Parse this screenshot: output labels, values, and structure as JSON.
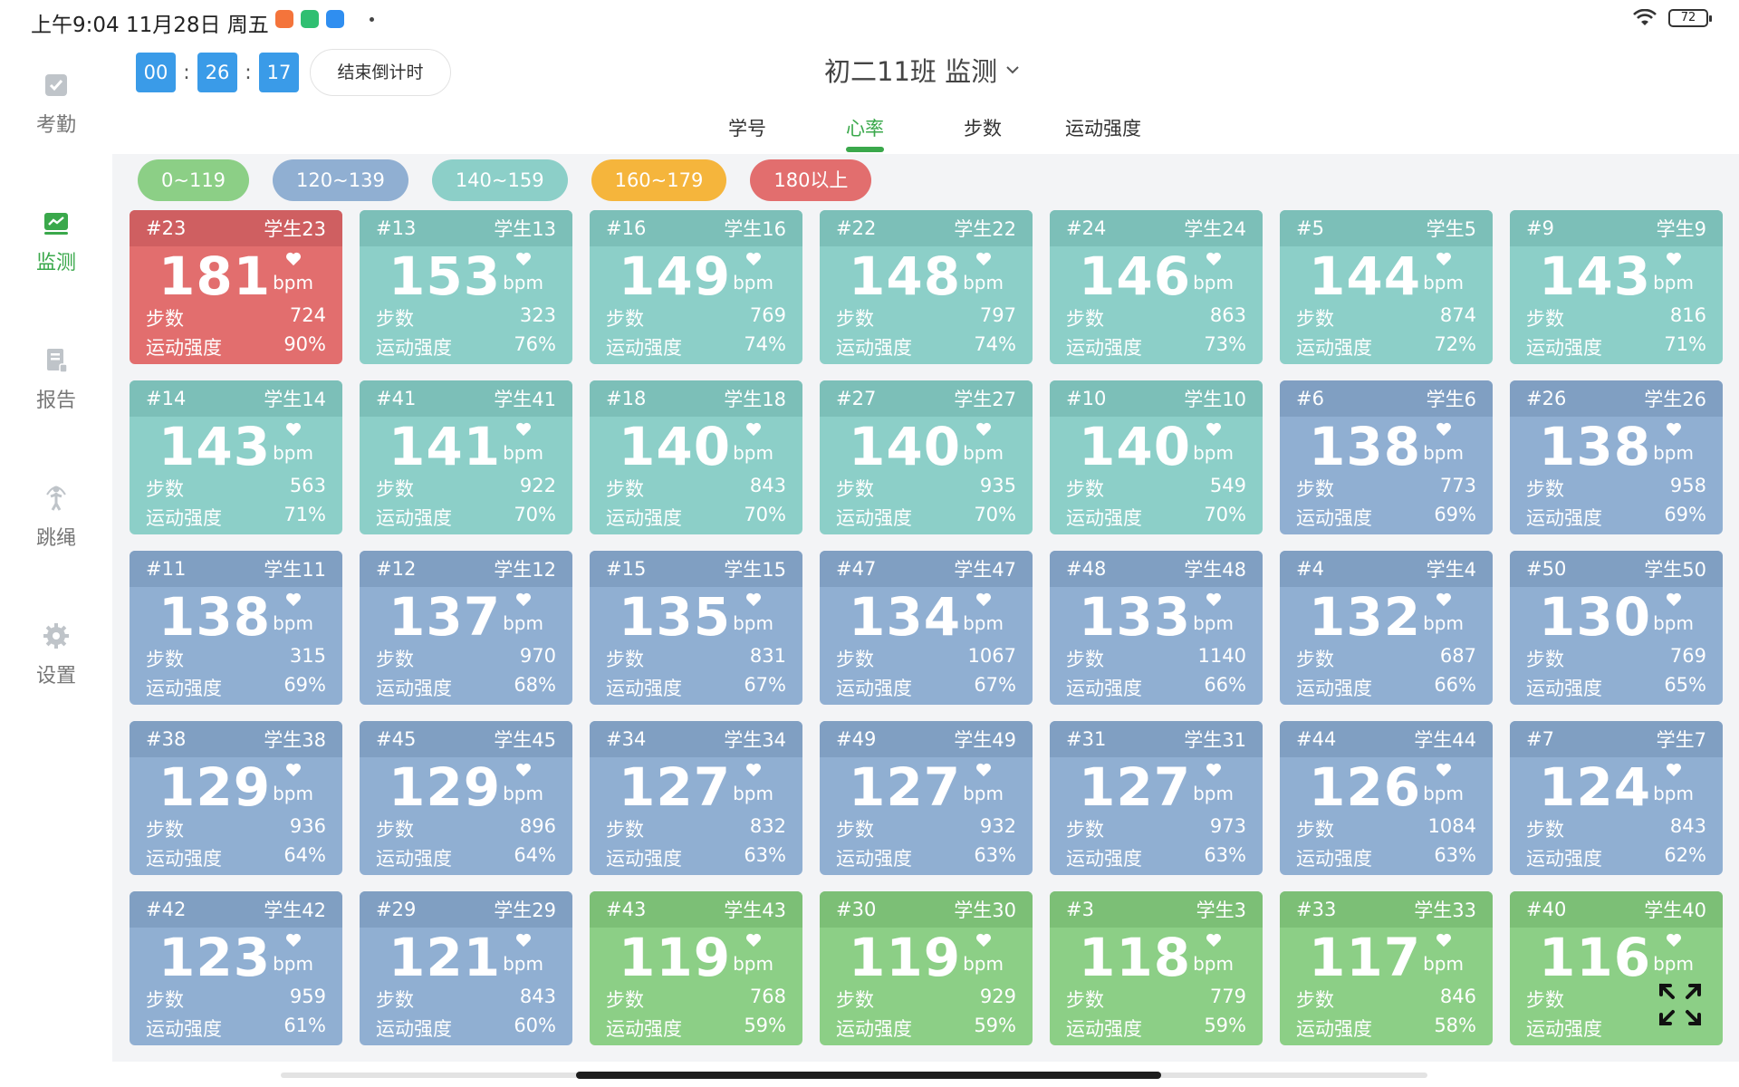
{
  "status": {
    "time": "上午9:04 11月28日 周五",
    "battery": "72"
  },
  "sidebar": {
    "items": [
      {
        "label": "考勤",
        "icon": "check-icon",
        "active": false
      },
      {
        "label": "监测",
        "icon": "monitor-chart-icon",
        "active": true
      },
      {
        "label": "报告",
        "icon": "report-icon",
        "active": false
      },
      {
        "label": "跳绳",
        "icon": "jump-rope-icon",
        "active": false
      },
      {
        "label": "设置",
        "icon": "gear-icon",
        "active": false
      }
    ]
  },
  "timer": {
    "h": "00",
    "m": "26",
    "s": "17",
    "sep": ":"
  },
  "end_button": "结束倒计时",
  "class_title": "初二11班 监测",
  "tabs": [
    {
      "label": "学号",
      "active": false
    },
    {
      "label": "心率",
      "active": true
    },
    {
      "label": "步数",
      "active": false
    },
    {
      "label": "运动强度",
      "active": false
    }
  ],
  "legend": [
    {
      "label": "0~119",
      "color": "#8ccf86"
    },
    {
      "label": "120~139",
      "color": "#90afd2"
    },
    {
      "label": "140~159",
      "color": "#8ccfc8"
    },
    {
      "label": "160~179",
      "color": "#f5b53c"
    },
    {
      "label": "180以上",
      "color": "#e26e6e"
    }
  ],
  "labels": {
    "unit": "bpm",
    "steps": "步数",
    "intensity": "运动强度"
  },
  "students": [
    {
      "id": "#23",
      "name": "学生23",
      "hr": "181",
      "steps": "724",
      "intensity": "90%"
    },
    {
      "id": "#13",
      "name": "学生13",
      "hr": "153",
      "steps": "323",
      "intensity": "76%"
    },
    {
      "id": "#16",
      "name": "学生16",
      "hr": "149",
      "steps": "769",
      "intensity": "74%"
    },
    {
      "id": "#22",
      "name": "学生22",
      "hr": "148",
      "steps": "797",
      "intensity": "74%"
    },
    {
      "id": "#24",
      "name": "学生24",
      "hr": "146",
      "steps": "863",
      "intensity": "73%"
    },
    {
      "id": "#5",
      "name": "学生5",
      "hr": "144",
      "steps": "874",
      "intensity": "72%"
    },
    {
      "id": "#9",
      "name": "学生9",
      "hr": "143",
      "steps": "816",
      "intensity": "71%"
    },
    {
      "id": "#14",
      "name": "学生14",
      "hr": "143",
      "steps": "563",
      "intensity": "71%"
    },
    {
      "id": "#41",
      "name": "学生41",
      "hr": "141",
      "steps": "922",
      "intensity": "70%"
    },
    {
      "id": "#18",
      "name": "学生18",
      "hr": "140",
      "steps": "843",
      "intensity": "70%"
    },
    {
      "id": "#27",
      "name": "学生27",
      "hr": "140",
      "steps": "935",
      "intensity": "70%"
    },
    {
      "id": "#10",
      "name": "学生10",
      "hr": "140",
      "steps": "549",
      "intensity": "70%"
    },
    {
      "id": "#6",
      "name": "学生6",
      "hr": "138",
      "steps": "773",
      "intensity": "69%"
    },
    {
      "id": "#26",
      "name": "学生26",
      "hr": "138",
      "steps": "958",
      "intensity": "69%"
    },
    {
      "id": "#11",
      "name": "学生11",
      "hr": "138",
      "steps": "315",
      "intensity": "69%"
    },
    {
      "id": "#12",
      "name": "学生12",
      "hr": "137",
      "steps": "970",
      "intensity": "68%"
    },
    {
      "id": "#15",
      "name": "学生15",
      "hr": "135",
      "steps": "831",
      "intensity": "67%"
    },
    {
      "id": "#47",
      "name": "学生47",
      "hr": "134",
      "steps": "1067",
      "intensity": "67%"
    },
    {
      "id": "#48",
      "name": "学生48",
      "hr": "133",
      "steps": "1140",
      "intensity": "66%"
    },
    {
      "id": "#4",
      "name": "学生4",
      "hr": "132",
      "steps": "687",
      "intensity": "66%"
    },
    {
      "id": "#50",
      "name": "学生50",
      "hr": "130",
      "steps": "769",
      "intensity": "65%"
    },
    {
      "id": "#38",
      "name": "学生38",
      "hr": "129",
      "steps": "936",
      "intensity": "64%"
    },
    {
      "id": "#45",
      "name": "学生45",
      "hr": "129",
      "steps": "896",
      "intensity": "64%"
    },
    {
      "id": "#34",
      "name": "学生34",
      "hr": "127",
      "steps": "832",
      "intensity": "63%"
    },
    {
      "id": "#49",
      "name": "学生49",
      "hr": "127",
      "steps": "932",
      "intensity": "63%"
    },
    {
      "id": "#31",
      "name": "学生31",
      "hr": "127",
      "steps": "973",
      "intensity": "63%"
    },
    {
      "id": "#44",
      "name": "学生44",
      "hr": "126",
      "steps": "1084",
      "intensity": "63%"
    },
    {
      "id": "#7",
      "name": "学生7",
      "hr": "124",
      "steps": "843",
      "intensity": "62%"
    },
    {
      "id": "#42",
      "name": "学生42",
      "hr": "123",
      "steps": "959",
      "intensity": "61%"
    },
    {
      "id": "#29",
      "name": "学生29",
      "hr": "121",
      "steps": "843",
      "intensity": "60%"
    },
    {
      "id": "#43",
      "name": "学生43",
      "hr": "119",
      "steps": "768",
      "intensity": "59%"
    },
    {
      "id": "#30",
      "name": "学生30",
      "hr": "119",
      "steps": "929",
      "intensity": "59%"
    },
    {
      "id": "#3",
      "name": "学生3",
      "hr": "118",
      "steps": "779",
      "intensity": "59%"
    },
    {
      "id": "#33",
      "name": "学生33",
      "hr": "117",
      "steps": "846",
      "intensity": "58%"
    },
    {
      "id": "#40",
      "name": "学生40",
      "hr": "116",
      "steps": "",
      "intensity": ""
    }
  ]
}
